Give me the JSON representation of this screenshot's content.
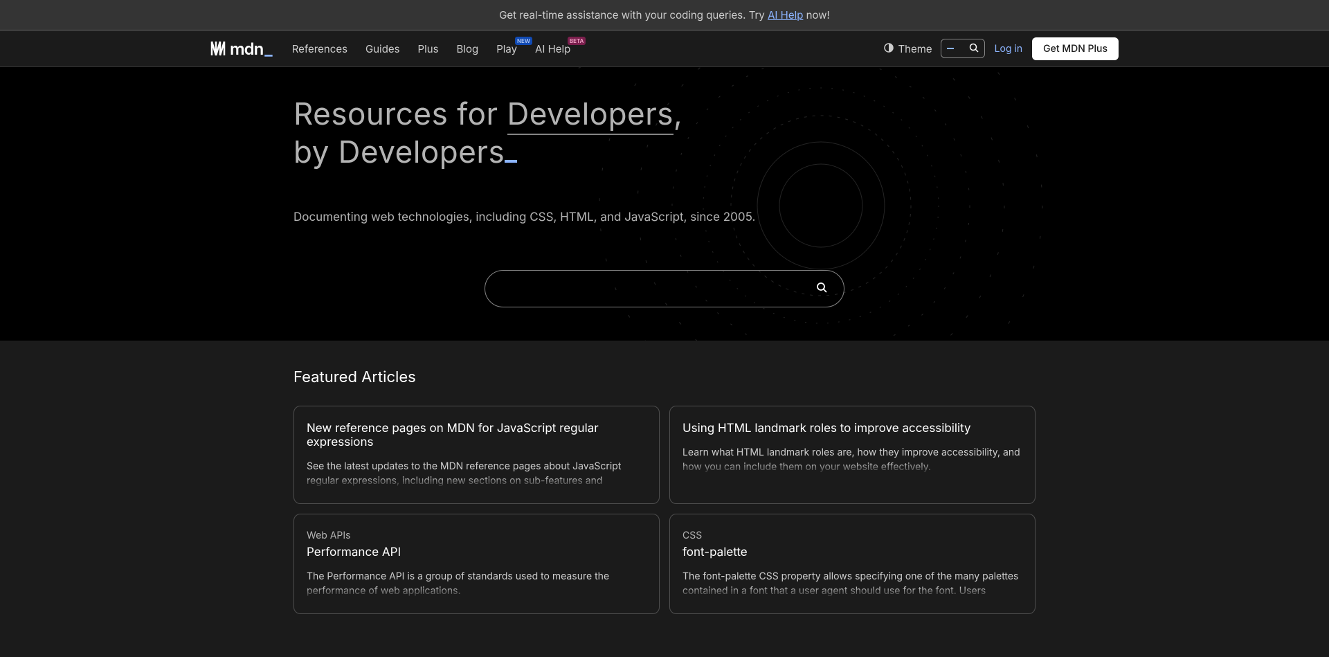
{
  "banner": {
    "prefix": "Get real-time assistance with your coding queries. Try ",
    "link": "AI Help",
    "suffix": " now!"
  },
  "logo_text": "mdn",
  "nav": {
    "items": [
      {
        "label": "References",
        "badge": ""
      },
      {
        "label": "Guides",
        "badge": ""
      },
      {
        "label": "Plus",
        "badge": ""
      },
      {
        "label": "Blog",
        "badge": ""
      },
      {
        "label": "Play",
        "badge": "NEW",
        "badge_class": "badge-new"
      },
      {
        "label": "AI Help",
        "badge": "BETA",
        "badge_class": "badge-beta"
      }
    ]
  },
  "theme_label": "Theme",
  "login_label": "Log in",
  "cta_label": "Get MDN Plus",
  "hero": {
    "line1_a": "Resources for ",
    "line1_b": "Developers",
    "line1_c": ",",
    "line2": "by Developers",
    "sub": "Documenting web technologies, including CSS, HTML, and JavaScript, since 2005."
  },
  "section_title": "Featured Articles",
  "articles": [
    {
      "category": "",
      "title": "New reference pages on MDN for JavaScript regular expressions",
      "desc": "See the latest updates to the MDN reference pages about JavaScript regular expressions, including new sections on sub-features and"
    },
    {
      "category": "",
      "title": "Using HTML landmark roles to improve accessibility",
      "desc": "Learn what HTML landmark roles are, how they improve accessibility, and how you can include them on your website effectively."
    },
    {
      "category": "Web APIs",
      "title": "Performance API",
      "desc": "The Performance API is a group of standards used to measure the performance of web applications."
    },
    {
      "category": "CSS",
      "title": "font-palette",
      "desc": "The font-palette CSS property allows specifying one of the many palettes contained in a font that a user agent should use for the font. Users"
    }
  ]
}
